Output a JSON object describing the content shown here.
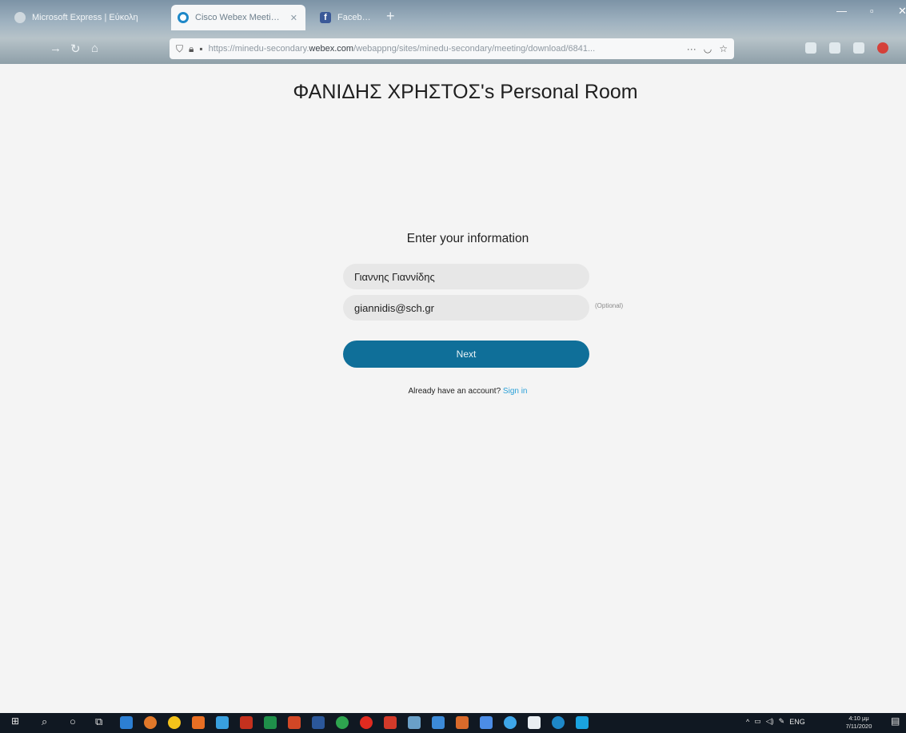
{
  "browser": {
    "tabs": [
      {
        "title": "Microsoft Express | Εύκολη",
        "favicon": "app-icon"
      },
      {
        "title": "Cisco Webex Meetings Web...",
        "favicon": "webex-icon"
      },
      {
        "title": "Facebook | Ευτύχιος & Αρ...",
        "favicon": "facebook-icon"
      }
    ],
    "url_prefix": "https://minedu-secondary.",
    "url_domain": "webex.com",
    "url_path": "/webappng/sites/minedu-secondary/meeting/download/6841...",
    "url_more": "···"
  },
  "page": {
    "room_title": "ΦΑΝΙΔΗΣ ΧΡΗΣΤΟΣ's Personal Room",
    "form_title": "Enter your information",
    "name_value": "Γιαννης Γιαννίδης",
    "email_value": "giannidis@sch.gr",
    "optional_label": "(Optional)",
    "next_label": "Next",
    "account_prompt": "Already have an account?",
    "signin_label": "Sign in",
    "accent_color": "#0f6f99",
    "link_color": "#2aa0d8"
  },
  "taskbar": {
    "tray_lang": "ENG",
    "clock_time": "4:10 μμ",
    "clock_date": "7/11/2020"
  }
}
